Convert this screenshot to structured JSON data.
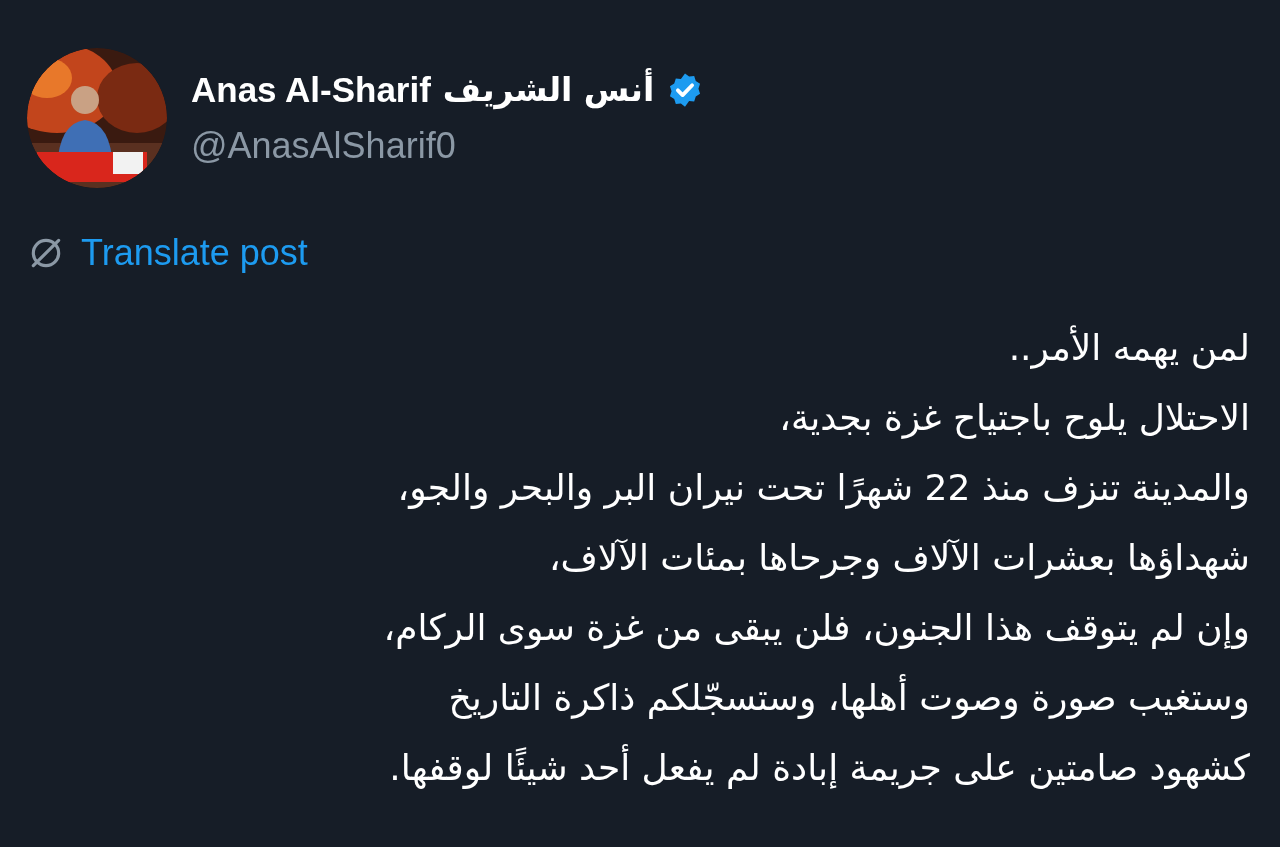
{
  "author": {
    "name": "Anas Al-Sharif",
    "name_arabic": "أنس الشريف",
    "verified": true,
    "handle": "@AnasAlSharif0"
  },
  "translate": {
    "label": "Translate post"
  },
  "post": {
    "lines": [
      "لمن يهمه الأمر..",
      "الاحتلال يلوح باجتياح غزة بجدية،",
      "والمدينة تنزف منذ 22 شهرًا تحت نيران البر والبحر والجو،",
      "شهداؤها بعشرات الآلاف وجرحاها بمئات الآلاف،",
      "وإن لم يتوقف هذا الجنون، فلن يبقى من غزة سوى الركام،",
      "وستغيب صورة وصوت أهلها، وستسجّلكم ذاكرة التاريخ",
      "كشهود صامتين على جريمة إبادة لم يفعل أحد شيئًا لوقفها."
    ]
  }
}
